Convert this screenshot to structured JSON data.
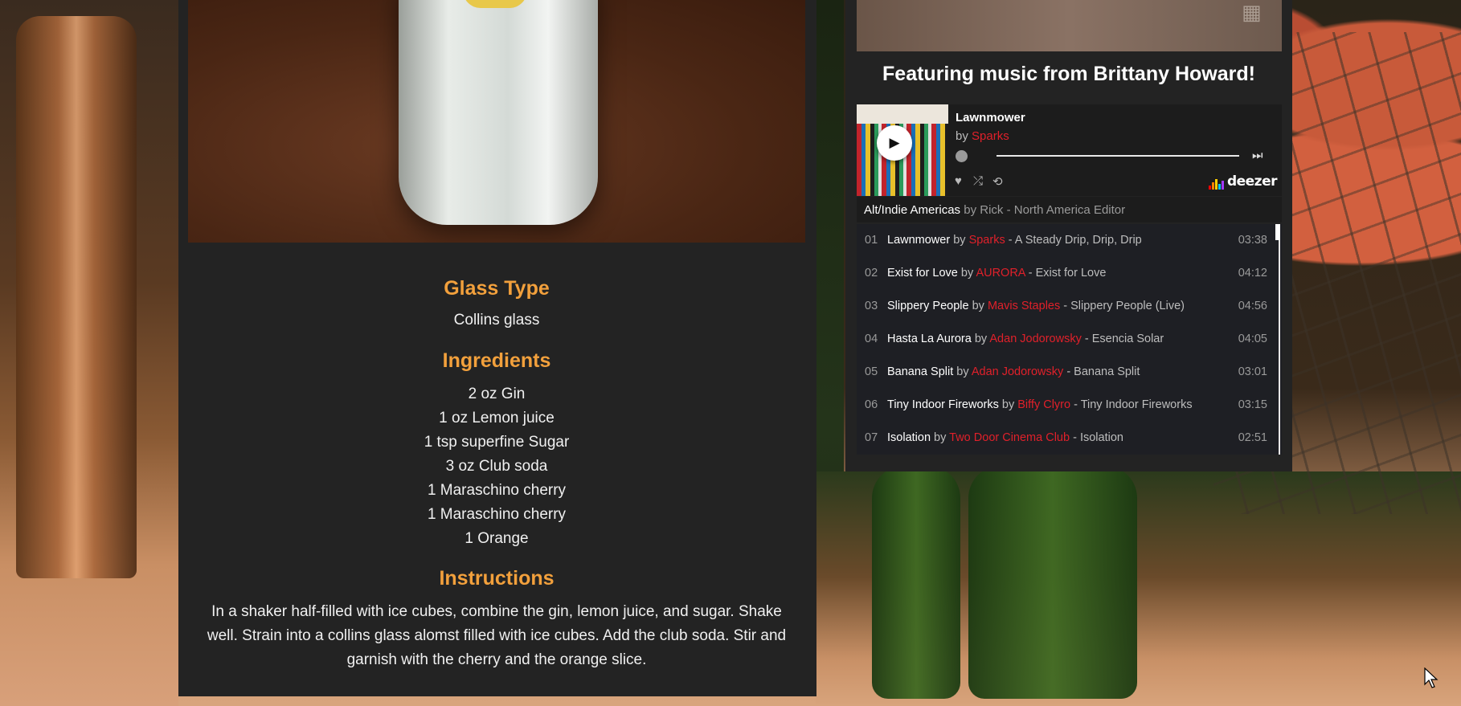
{
  "recipe": {
    "glass_heading": "Glass Type",
    "glass_type": "Collins glass",
    "ingredients_heading": "Ingredients",
    "ingredients": [
      "2 oz Gin",
      "1 oz Lemon juice",
      "1 tsp superfine Sugar",
      "3 oz Club soda",
      "1 Maraschino cherry",
      "1 Maraschino cherry",
      "1 Orange"
    ],
    "instructions_heading": "Instructions",
    "instructions": "In a shaker half-filled with ice cubes, combine the gin, lemon juice, and sugar. Shake well. Strain into a collins glass alomst filled with ice cubes. Add the club soda. Stir and garnish with the cherry and the orange slice."
  },
  "music": {
    "heading": "Featuring music from Brittany Howard!",
    "player": {
      "title": "Lawnmower",
      "by_label": "by",
      "artist": "Sparks",
      "brand": "deezer"
    },
    "playlist": {
      "name": "Alt/Indie Americas",
      "by_label": "by",
      "author": "Rick - North America Editor"
    },
    "tracks": [
      {
        "num": "01",
        "name": "Lawnmower",
        "by": "by",
        "artist": "Sparks",
        "album": "- A Steady Drip, Drip, Drip",
        "duration": "03:38"
      },
      {
        "num": "02",
        "name": "Exist for Love",
        "by": "by",
        "artist": "AURORA",
        "album": "- Exist for Love",
        "duration": "04:12"
      },
      {
        "num": "03",
        "name": "Slippery People",
        "by": "by",
        "artist": "Mavis Staples",
        "album": "- Slippery People (Live)",
        "duration": "04:56"
      },
      {
        "num": "04",
        "name": "Hasta La Aurora",
        "by": "by",
        "artist": "Adan Jodorowsky",
        "album": "- Esencia Solar",
        "duration": "04:05"
      },
      {
        "num": "05",
        "name": "Banana Split",
        "by": "by",
        "artist": "Adan Jodorowsky",
        "album": "- Banana Split",
        "duration": "03:01"
      },
      {
        "num": "06",
        "name": "Tiny Indoor Fireworks",
        "by": "by",
        "artist": "Biffy Clyro",
        "album": "- Tiny Indoor Fireworks",
        "duration": "03:15"
      },
      {
        "num": "07",
        "name": "Isolation",
        "by": "by",
        "artist": "Two Door Cinema Club",
        "album": "- Isolation",
        "duration": "02:51"
      }
    ]
  },
  "colors": {
    "heading_accent": "#f2a03c",
    "artist_red": "#e0202a",
    "panel_bg": "#232323"
  },
  "icons": [
    "play-icon",
    "clock-icon",
    "next-icon",
    "heart-icon",
    "shuffle-icon",
    "repeat-icon",
    "deezer-logo",
    "grid-icon",
    "cursor-icon"
  ]
}
